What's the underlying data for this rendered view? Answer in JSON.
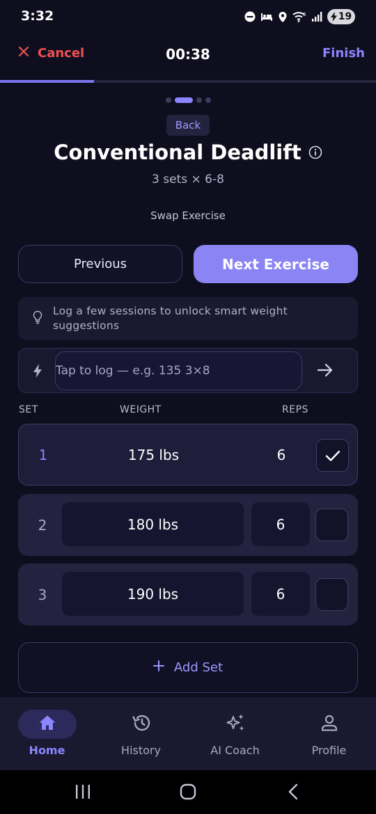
{
  "status_bar": {
    "time": "3:32",
    "battery": "19"
  },
  "header": {
    "cancel_label": "Cancel",
    "timer": "00:38",
    "finish_label": "Finish",
    "progress_fraction": 0.25
  },
  "exercise": {
    "pager": {
      "count": 4,
      "active_index": 1
    },
    "back_label": "Back",
    "title": "Conventional Deadlift",
    "subtitle": "3 sets × 6-8",
    "swap_label": "Swap Exercise"
  },
  "navigation": {
    "previous_label": "Previous",
    "next_label": "Next Exercise"
  },
  "tip": {
    "text": "Log a few sessions to unlock smart weight suggestions"
  },
  "quick_log": {
    "placeholder": "Tap to log — e.g. 135 3×8"
  },
  "table": {
    "headers": {
      "set": "SET",
      "weight": "WEIGHT",
      "reps": "REPS"
    },
    "sets": [
      {
        "number": "1",
        "weight": "175 lbs",
        "reps": "6",
        "completed": true
      },
      {
        "number": "2",
        "weight": "180 lbs",
        "reps": "6",
        "completed": false
      },
      {
        "number": "3",
        "weight": "190 lbs",
        "reps": "6",
        "completed": false
      }
    ]
  },
  "add_set_label": "Add Set",
  "bottom_nav": {
    "items": [
      {
        "label": "Home",
        "icon": "home-icon",
        "active": true
      },
      {
        "label": "History",
        "icon": "history-icon",
        "active": false
      },
      {
        "label": "AI Coach",
        "icon": "sparkles-icon",
        "active": false
      },
      {
        "label": "Profile",
        "icon": "person-icon",
        "active": false
      }
    ]
  },
  "colors": {
    "background": "#0f0e1f",
    "accent": "#8a84f5",
    "danger": "#f0524f",
    "card": "#24233f"
  }
}
